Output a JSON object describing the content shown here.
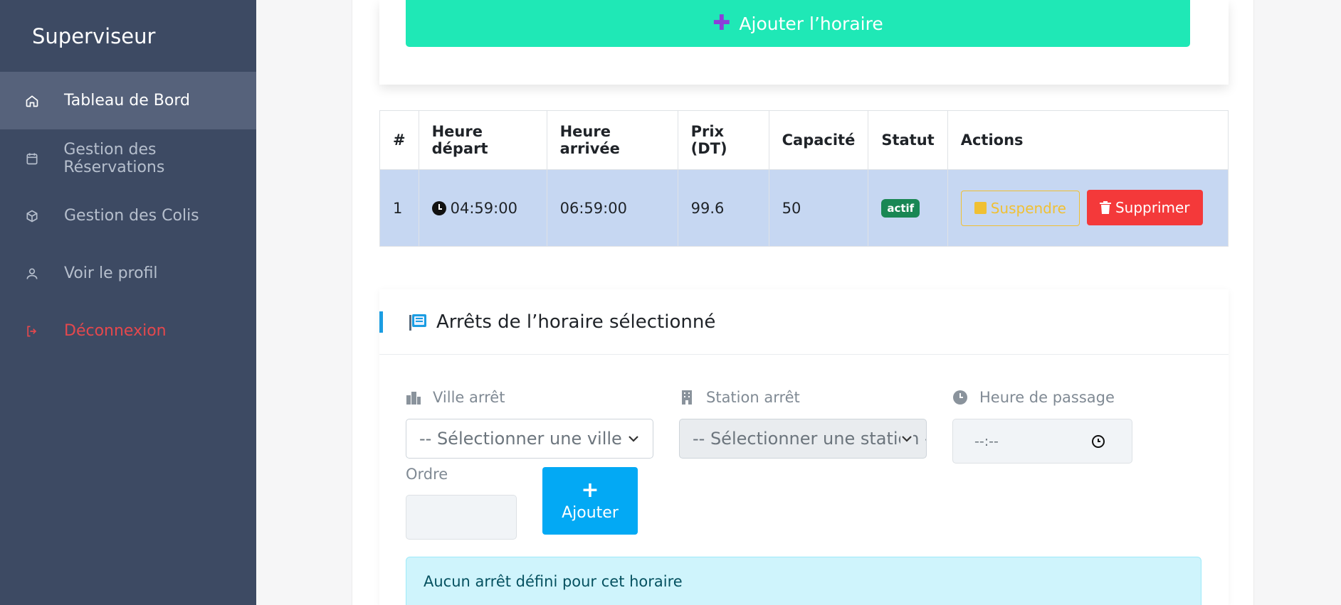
{
  "sidebar": {
    "brand": "Superviseur",
    "items": [
      {
        "label": "Tableau de Bord",
        "icon": "home-icon"
      },
      {
        "label": "Gestion des Réservations",
        "icon": "calendar-icon"
      },
      {
        "label": "Gestion des Colis",
        "icon": "box-icon"
      },
      {
        "label": "Voir le profil",
        "icon": "user-icon"
      },
      {
        "label": "Déconnexion",
        "icon": "logout-icon"
      }
    ]
  },
  "top": {
    "add_horaire_label": "Ajouter l’horaire"
  },
  "table": {
    "headers": [
      "#",
      "Heure départ",
      "Heure arrivée",
      "Prix (DT)",
      "Capacité",
      "Statut",
      "Actions"
    ],
    "rows": [
      {
        "num": "1",
        "depart": "04:59:00",
        "arrivee": "06:59:00",
        "prix": "99.6",
        "capacite": "50",
        "statut": "actif",
        "suspend_label": "Suspendre",
        "delete_label": "Supprimer"
      }
    ]
  },
  "stops": {
    "title": "Arrêts de l’horaire sélectionné",
    "ville_label": "Ville arrêt",
    "ville_placeholder": "-- Sélectionner une ville --",
    "station_label": "Station arrêt",
    "station_placeholder": "-- Sélectionner une station --",
    "heure_label": "Heure de passage",
    "heure_placeholder": "--:--",
    "ordre_label": "Ordre",
    "ajouter_label": "Ajouter",
    "empty_message": "Aucun arrêt défini pour cet horaire"
  },
  "colors": {
    "sidebar_bg": "#3d4a63",
    "sidebar_active": "#56627b",
    "accent_green": "#1fe8b6",
    "row_highlight": "#c6d7f2",
    "danger": "#f4393a",
    "warning": "#f0c033",
    "info_btn": "#03a9f4"
  }
}
